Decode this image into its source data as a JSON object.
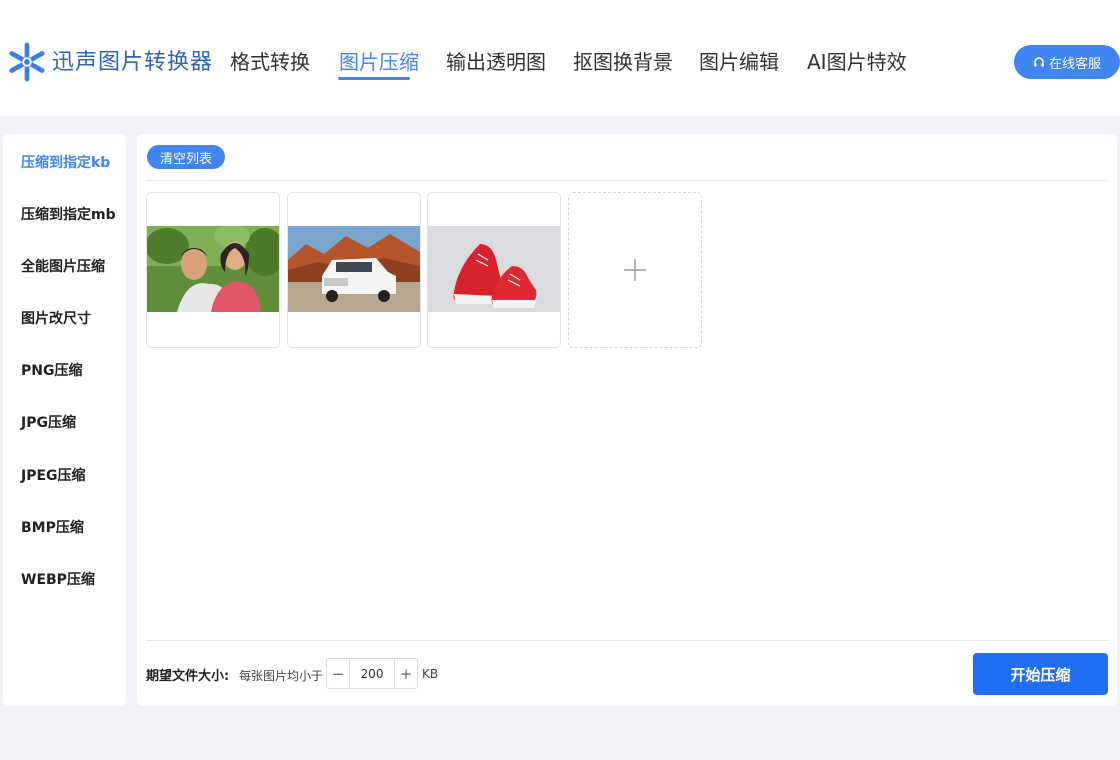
{
  "header": {
    "brand": "迅声图片转换器",
    "logo_icon": "snowflake-logo-icon",
    "nav": [
      {
        "label": "格式转换",
        "active": false
      },
      {
        "label": "图片压缩",
        "active": true
      },
      {
        "label": "输出透明图",
        "active": false
      },
      {
        "label": "抠图换背景",
        "active": false
      },
      {
        "label": "图片编辑",
        "active": false
      },
      {
        "label": "AI图片特效",
        "active": false
      }
    ],
    "service_label": "在线客服",
    "service_icon": "headset-icon"
  },
  "sidebar": {
    "items": [
      {
        "label": "压缩到指定kb",
        "active": true
      },
      {
        "label": "压缩到指定mb",
        "active": false
      },
      {
        "label": "全能图片压缩",
        "active": false
      },
      {
        "label": "图片改尺寸",
        "active": false
      },
      {
        "label": "PNG压缩",
        "active": false
      },
      {
        "label": "JPG压缩",
        "active": false
      },
      {
        "label": "JPEG压缩",
        "active": false
      },
      {
        "label": "BMP压缩",
        "active": false
      },
      {
        "label": "WEBP压缩",
        "active": false
      }
    ]
  },
  "main": {
    "clear_label": "清空列表",
    "thumbnails": [
      "couple-photo",
      "suv-photo",
      "red-sneakers-photo"
    ],
    "add_icon": "plus-icon",
    "size_label": "期望文件大小:",
    "size_hint": "每张图片均小于",
    "size_value": "200",
    "size_unit": "KB",
    "minus_label": "−",
    "plus_label": "+",
    "start_label": "开始压缩"
  },
  "colors": {
    "accent": "#3f86f0",
    "primary_button": "#1f6ff0",
    "brand_text": "#2f64b8",
    "page_bg": "#f1f3f9"
  }
}
